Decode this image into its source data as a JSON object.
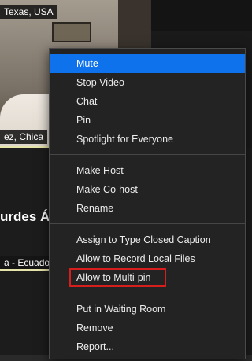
{
  "tiles": {
    "top_name": "Texas, USA",
    "middle_name": "ez, Chica",
    "big_name": "urdes Á",
    "bottom_name": "a - Ecuador"
  },
  "menu": {
    "groups": [
      [
        {
          "label": "Mute",
          "active": true
        },
        {
          "label": "Stop Video"
        },
        {
          "label": "Chat"
        },
        {
          "label": "Pin"
        },
        {
          "label": "Spotlight for Everyone"
        }
      ],
      [
        {
          "label": "Make Host"
        },
        {
          "label": "Make Co-host"
        },
        {
          "label": "Rename"
        }
      ],
      [
        {
          "label": "Assign to Type Closed Caption"
        },
        {
          "label": "Allow to Record Local Files"
        },
        {
          "label": "Allow to Multi-pin",
          "highlighted": true
        }
      ],
      [
        {
          "label": "Put in Waiting Room"
        },
        {
          "label": "Remove"
        },
        {
          "label": "Report..."
        }
      ]
    ]
  },
  "colors": {
    "menu_active": "#0e72ed",
    "highlight_border": "#d81d1d",
    "speaker_indicator": "#e6e4a8"
  }
}
